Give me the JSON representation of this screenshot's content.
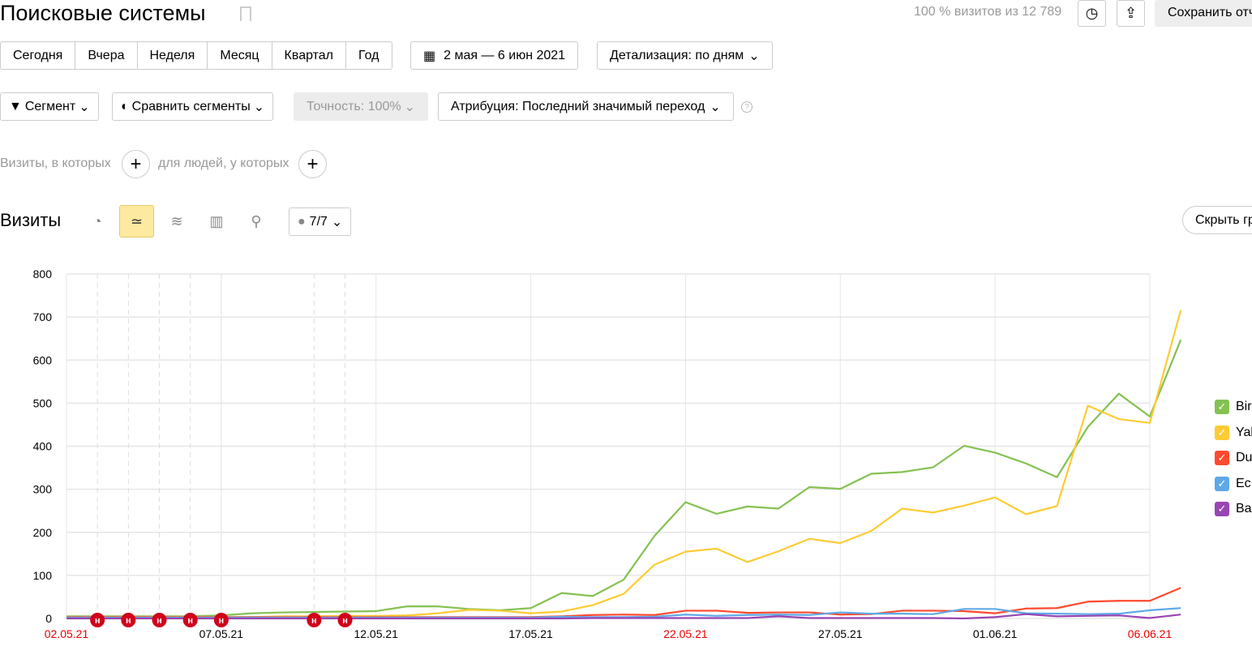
{
  "header": {
    "title": "Поисковые системы",
    "stat": "100 % визитов из 12 789",
    "save_label": "Сохранить отч"
  },
  "periods": [
    "Сегодня",
    "Вчера",
    "Неделя",
    "Месяц",
    "Квартал",
    "Год"
  ],
  "date_range": "2 мая — 6 июн 2021",
  "detail": "Детализация: по дням",
  "filters": {
    "segment": "Сегмент",
    "compare": "Сравнить сегменты",
    "accuracy": "Точность: 100%",
    "attribution": "Атрибуция: Последний значимый переход",
    "help": "?"
  },
  "conditions": {
    "visits": "Визиты, в которых",
    "people": "для людей, у которых"
  },
  "chart_header": {
    "title": "Визиты",
    "series_count": "7/7",
    "hide_label": "Скрыть гр"
  },
  "legend": [
    {
      "label": "Bir",
      "color": "#85c152"
    },
    {
      "label": "Yal",
      "color": "#fdcb33"
    },
    {
      "label": "Du",
      "color": "#fe4a2f"
    },
    {
      "label": "Ec",
      "color": "#5ea9e7"
    },
    {
      "label": "Ba",
      "color": "#9945b3"
    }
  ],
  "chart_data": {
    "type": "line",
    "ylim": [
      0,
      800
    ],
    "yticks": [
      0,
      100,
      200,
      300,
      400,
      500,
      600,
      700,
      800
    ],
    "x": [
      "02.05.21",
      "03.05.21",
      "04.05.21",
      "05.05.21",
      "06.05.21",
      "07.05.21",
      "08.05.21",
      "09.05.21",
      "10.05.21",
      "11.05.21",
      "12.05.21",
      "13.05.21",
      "14.05.21",
      "15.05.21",
      "16.05.21",
      "17.05.21",
      "18.05.21",
      "19.05.21",
      "20.05.21",
      "21.05.21",
      "22.05.21",
      "23.05.21",
      "24.05.21",
      "25.05.21",
      "26.05.21",
      "27.05.21",
      "28.05.21",
      "29.05.21",
      "30.05.21",
      "31.05.21",
      "01.06.21",
      "02.06.21",
      "03.06.21",
      "04.06.21",
      "05.06.21",
      "06.06.21"
    ],
    "xtick_labels": [
      "02.05.21",
      "07.05.21",
      "12.05.21",
      "17.05.21",
      "22.05.21",
      "27.05.21",
      "01.06.21",
      "06.06.21"
    ],
    "red_xtick_labels": [
      "02.05.21",
      "22.05.21",
      "06.06.21"
    ],
    "holiday_marker": "н",
    "holidays": [
      "03.05.21",
      "04.05.21",
      "05.05.21",
      "06.05.21",
      "07.05.21",
      "10.05.21",
      "11.05.21"
    ],
    "series": [
      {
        "color": "#85c152",
        "values": [
          5,
          5,
          5,
          5,
          5,
          7,
          12,
          14,
          15,
          16,
          17,
          28,
          28,
          22,
          19,
          24,
          59,
          52,
          90,
          192,
          270,
          243,
          260,
          255,
          305,
          301,
          336,
          340,
          351,
          401,
          385,
          360,
          328,
          445,
          522,
          469,
          647
        ]
      },
      {
        "color": "#fdcb33",
        "values": [
          3,
          3,
          3,
          3,
          3,
          3,
          3,
          5,
          5,
          6,
          6,
          7,
          12,
          20,
          18,
          12,
          16,
          31,
          57,
          125,
          155,
          162,
          131,
          156,
          185,
          175,
          203,
          255,
          246,
          262,
          281,
          242,
          261,
          494,
          463,
          454,
          716
        ]
      },
      {
        "color": "#fe4a2f",
        "values": [
          3,
          3,
          3,
          3,
          3,
          3,
          3,
          3,
          3,
          3,
          3,
          3,
          3,
          3,
          3,
          3,
          5,
          8,
          9,
          8,
          18,
          18,
          13,
          14,
          14,
          9,
          10,
          18,
          18,
          17,
          12,
          23,
          24,
          39,
          41,
          41,
          71
        ]
      },
      {
        "color": "#5ea9e7",
        "values": [
          2,
          2,
          2,
          2,
          2,
          2,
          2,
          2,
          2,
          2,
          2,
          2,
          2,
          2,
          2,
          2,
          4,
          3,
          3,
          4,
          9,
          6,
          8,
          9,
          8,
          14,
          11,
          11,
          10,
          22,
          22,
          12,
          11,
          10,
          11,
          19,
          24
        ]
      },
      {
        "color": "#9945b3",
        "values": [
          0,
          0,
          0,
          0,
          0,
          0,
          0,
          0,
          0,
          0,
          0,
          0,
          0,
          0,
          0,
          0,
          0,
          1,
          1,
          1,
          1,
          1,
          1,
          5,
          1,
          1,
          1,
          1,
          1,
          0,
          3,
          10,
          5,
          6,
          7,
          1,
          9
        ]
      }
    ]
  }
}
